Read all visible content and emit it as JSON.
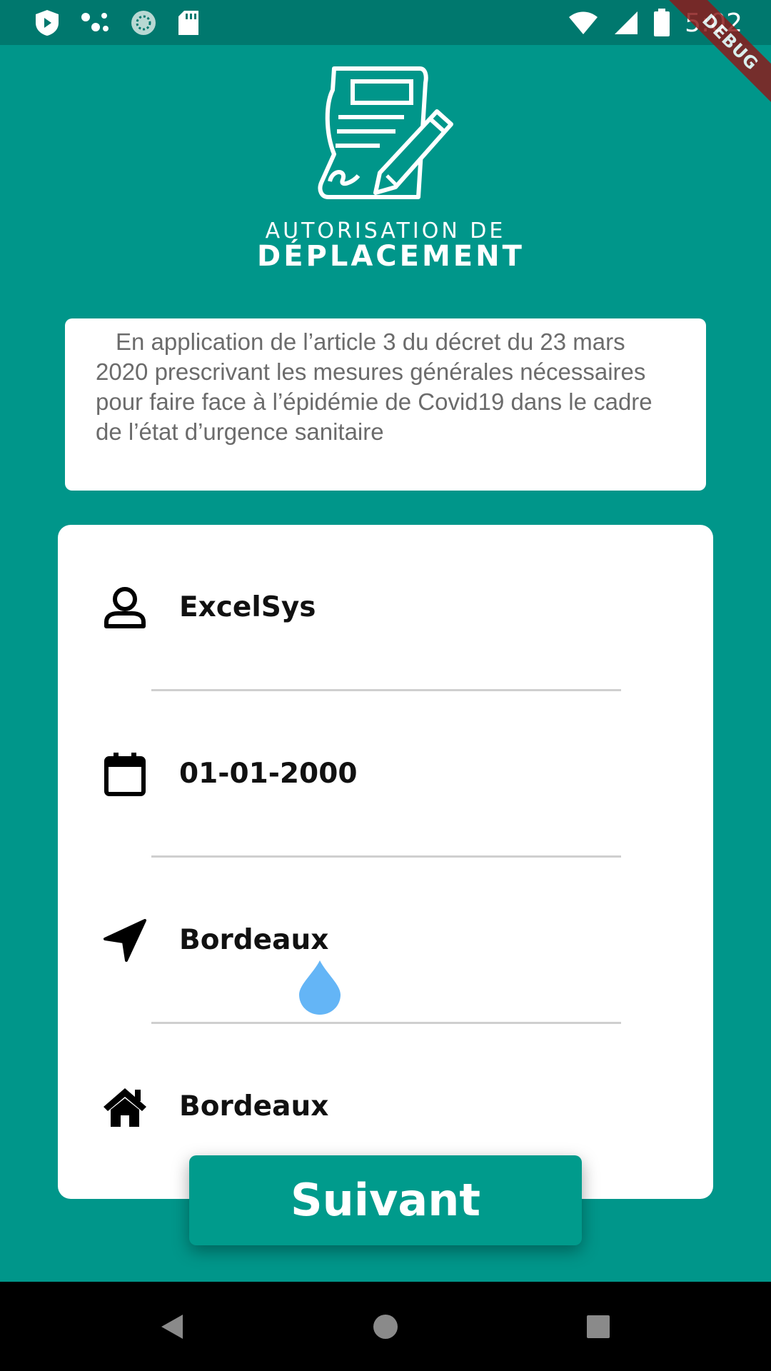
{
  "status_bar": {
    "time": "5:02",
    "left_icons": [
      "shield-play-icon",
      "dots-icon",
      "sync-icon",
      "sd-card-icon"
    ],
    "right_icons": [
      "wifi-icon",
      "signal-icon",
      "battery-icon"
    ]
  },
  "debug_banner": "DEBUG",
  "logo": {
    "line1": "AUTORISATION DE",
    "line2": "DÉPLACEMENT",
    "icon": "document-pen-icon"
  },
  "info_text": "En application de l’article 3 du décret du 23 mars 2020 prescrivant les mesures générales nécessaires pour faire face à l’épidémie de Covid19 dans le cadre de l’état d’urgence sanitaire",
  "form": {
    "fields": [
      {
        "icon": "person-icon",
        "value": "ExcelSys"
      },
      {
        "icon": "calendar-icon",
        "value": "01-01-2000"
      },
      {
        "icon": "navigation-arrow-icon",
        "value": "Bordeaux"
      },
      {
        "icon": "home-icon",
        "value": "Bordeaux"
      }
    ]
  },
  "next_button": "Suivant",
  "colors": {
    "primary": "#00968a",
    "status_bar": "#00786e",
    "button": "#009b8c",
    "cursor_handle": "#64b5f6"
  },
  "nav_bar": [
    "back-icon",
    "home-circle-icon",
    "recents-icon"
  ]
}
